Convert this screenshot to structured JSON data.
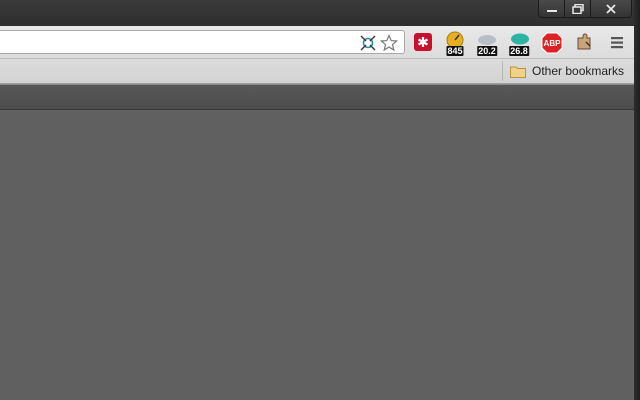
{
  "window": {
    "controls": {
      "minimize_icon": "minimize-icon",
      "restore_icon": "restore-icon",
      "close_icon": "close-icon"
    }
  },
  "omnibox": {
    "icons": [
      "page-action-network-icon",
      "bookmark-star-icon"
    ]
  },
  "extensions": [
    {
      "name": "lastpass",
      "icon": "asterisk-icon",
      "color": "#c8102e",
      "badge": ""
    },
    {
      "name": "ext-845",
      "icon": "gauge-icon",
      "color": "#e8b020",
      "badge": "845"
    },
    {
      "name": "ext-20",
      "icon": "cloud-gray-icon",
      "color": "#9aa3ad",
      "badge": "20.2"
    },
    {
      "name": "ext-26",
      "icon": "cloud-teal-icon",
      "color": "#2bb3a3",
      "badge": "26.8"
    },
    {
      "name": "adblock-plus",
      "icon": "abp-icon",
      "color": "#d22",
      "label": "ABP",
      "badge": ""
    },
    {
      "name": "puzzle-extension",
      "icon": "puzzle-icon",
      "color": "#a07050",
      "badge": ""
    },
    {
      "name": "menu",
      "icon": "hamburger-menu-icon",
      "color": "#555555",
      "badge": ""
    }
  ],
  "bookmarks_bar": {
    "other_bookmarks": "Other bookmarks"
  }
}
